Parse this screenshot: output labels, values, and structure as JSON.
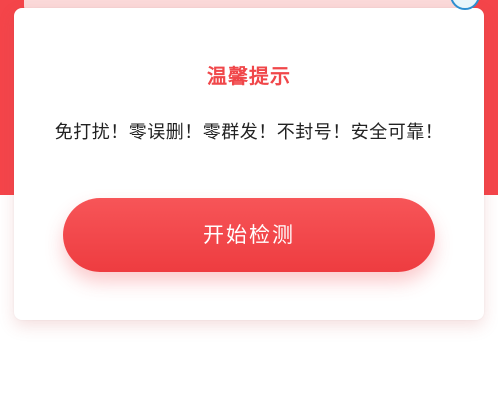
{
  "dialog": {
    "title": "温馨提示",
    "message": "免打扰！零误删！零群发！不封号！安全可靠！",
    "start_button_label": "开始检测"
  },
  "colors": {
    "header_red": "#f4454a",
    "accent_red": "#f0474a",
    "button_red": "#f75558"
  },
  "icons": {
    "close": "close-icon"
  }
}
